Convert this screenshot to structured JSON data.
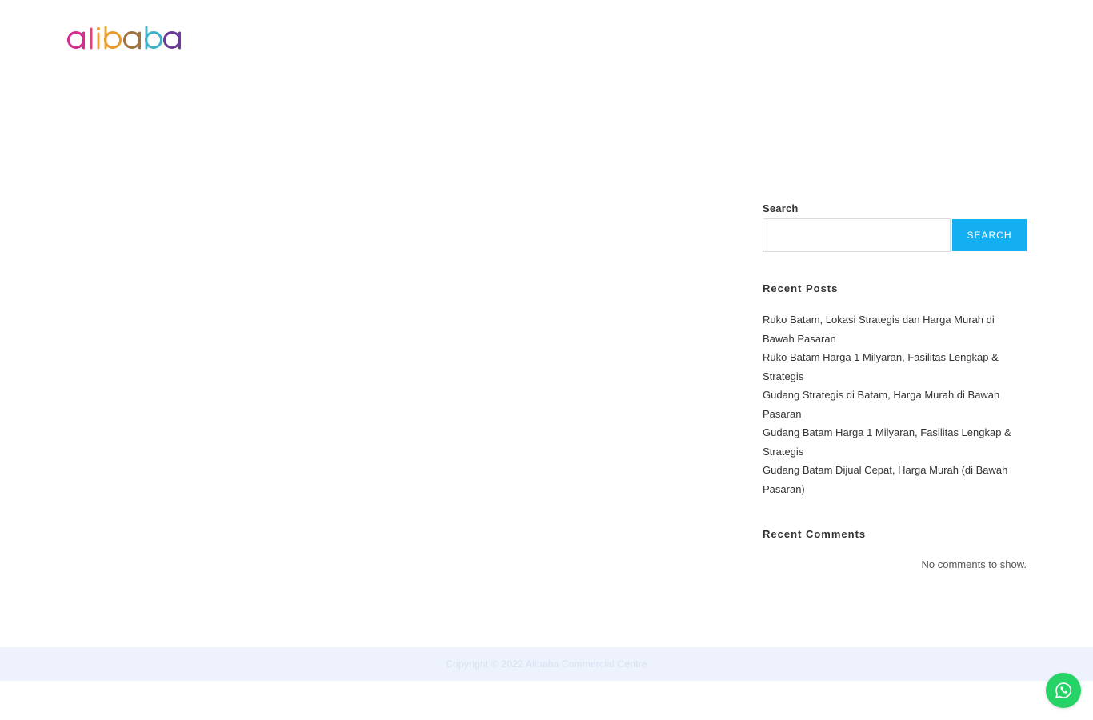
{
  "header": {
    "logo_text": "alibaba"
  },
  "sidebar": {
    "search": {
      "label": "Search",
      "input_value": "",
      "button_label": "Search"
    },
    "recent_posts": {
      "title": "Recent Posts",
      "items": [
        "Ruko Batam, Lokasi Strategis dan Harga Murah di Bawah Pasaran",
        "Ruko Batam Harga 1 Milyaran, Fasilitas Lengkap & Strategis",
        "Gudang Strategis di Batam, Harga Murah di Bawah Pasaran",
        "Gudang Batam Harga 1 Milyaran, Fasilitas Lengkap & Strategis",
        "Gudang Batam Dijual Cepat, Harga Murah (di Bawah Pasaran)"
      ]
    },
    "recent_comments": {
      "title": "Recent Comments",
      "empty_text": "No comments to show."
    }
  },
  "footer": {
    "copyright": "Copyright © 2022 Alibaba Commercial Centre"
  },
  "floating": {
    "whatsapp_icon": "whatsapp-icon"
  },
  "colors": {
    "accent": "#13aff0",
    "whatsapp": "#25d366",
    "footer_bg": "#edf2fc"
  }
}
